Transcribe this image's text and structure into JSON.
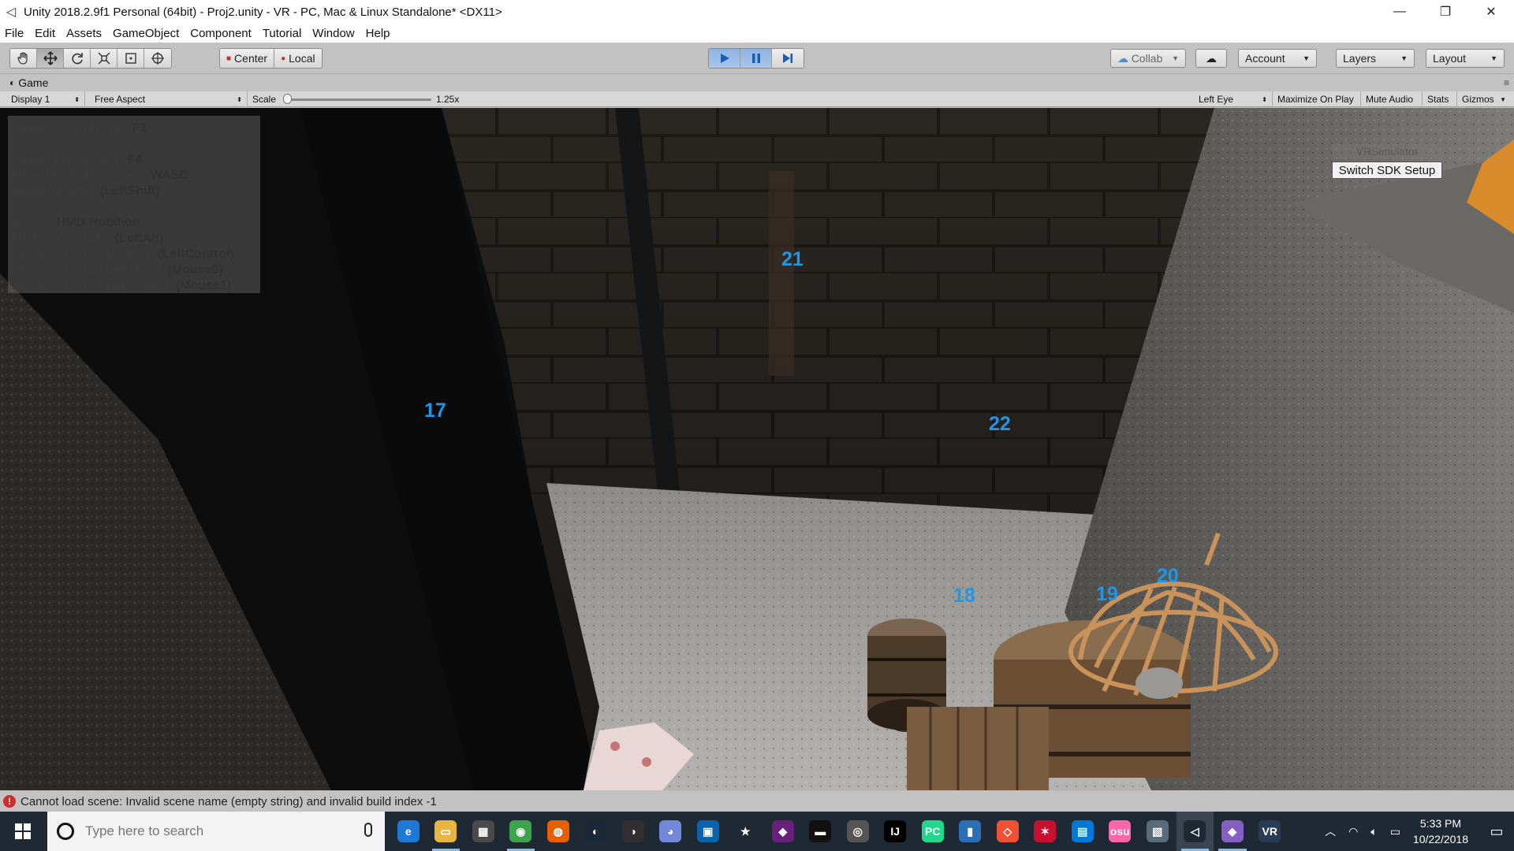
{
  "window": {
    "title": "Unity 2018.2.9f1 Personal (64bit) - Proj2.unity - VR - PC, Mac & Linux Standalone* <DX11>",
    "minimize_glyph": "—",
    "restore_glyph": "❐",
    "close_glyph": "✕"
  },
  "menu": [
    "File",
    "Edit",
    "Assets",
    "GameObject",
    "Component",
    "Tutorial",
    "Window",
    "Help"
  ],
  "toolbar": {
    "tools": [
      "hand-tool-icon",
      "move-tool-icon",
      "rotate-tool-icon",
      "scale-tool-icon",
      "rect-tool-icon",
      "transform-tool-icon"
    ],
    "pivot_center": "Center",
    "pivot_local": "Local",
    "collab": "Collab",
    "account": "Account",
    "layers": "Layers",
    "layout": "Layout"
  },
  "game_panel": {
    "tab_label": "Game",
    "display": "Display 1",
    "aspect": "Free Aspect",
    "scale_label": "Scale",
    "scale_value": "1.25x",
    "eye": "Left Eye",
    "maximize_on_play": "Maximize On Play",
    "mute_audio": "Mute Audio",
    "stats": "Stats",
    "gizmos": "Gizmos"
  },
  "hints": {
    "toggle_control_label": "Toggle Control Hints: ",
    "toggle_control_key": "F1",
    "toggle_mouse_label": "Toggle Mouse Lock: ",
    "toggle_mouse_key": "F4",
    "move_label": "Move Player/Playspace: ",
    "move_key": "WASD",
    "sprint_label": "Sprint Modifier: ",
    "sprint_key": "(LeftShift)",
    "mouse_label": "Mouse: ",
    "mouse_key": "HMD Rotation",
    "modes_label": "Modes: Controller ",
    "modes_key": "(LeftAlt)",
    "dist_mod_label": "Distance Pickup Modifier: ",
    "dist_mod_key": "(LeftControl)",
    "dist_left_label": "Distance Pickup Left Hand: ",
    "dist_left_key": "(Mouse0)",
    "dist_right_label": "Distance Pickup Right Hand: ",
    "dist_right_key": "(Mouse1)"
  },
  "sdk": {
    "simulator": "VRSimulator",
    "switch": "Switch SDK Setup"
  },
  "scene_labels": [
    "21",
    "17",
    "22",
    "20",
    "19",
    "18"
  ],
  "status": {
    "error": "Cannot load scene: Invalid scene name (empty string) and invalid build index -1"
  },
  "taskbar": {
    "search_placeholder": "Type here to search",
    "time": "5:33 PM",
    "date": "10/22/2018",
    "apps": [
      {
        "name": "edge-icon",
        "color": "#1e78d6",
        "glyph": "e"
      },
      {
        "name": "file-explorer-icon",
        "color": "#e8b640",
        "glyph": "▭"
      },
      {
        "name": "store-icon",
        "color": "#4a4a4a",
        "glyph": "▦"
      },
      {
        "name": "chrome-icon",
        "color": "#3fa34d",
        "glyph": "◉"
      },
      {
        "name": "firefox-icon",
        "color": "#e66000",
        "glyph": "◍"
      },
      {
        "name": "steam-icon",
        "color": "#1b2838",
        "glyph": "◐"
      },
      {
        "name": "obs-icon",
        "color": "#302e31",
        "glyph": "◑"
      },
      {
        "name": "discord-icon",
        "color": "#7289da",
        "glyph": "◕"
      },
      {
        "name": "outlook-icon",
        "color": "#0a64ad",
        "glyph": "▣"
      },
      {
        "name": "favorite-icon",
        "color": "#1f2933",
        "glyph": "★"
      },
      {
        "name": "visual-studio-icon",
        "color": "#68217a",
        "glyph": "◆"
      },
      {
        "name": "terminal-icon",
        "color": "#111111",
        "glyph": "▬"
      },
      {
        "name": "gamepad-icon",
        "color": "#555555",
        "glyph": "◎"
      },
      {
        "name": "intellij-icon",
        "color": "#000000",
        "glyph": "IJ"
      },
      {
        "name": "pycharm-icon",
        "color": "#21d789",
        "glyph": "PC"
      },
      {
        "name": "bookmark-app-icon",
        "color": "#2c6fb5",
        "glyph": "▮"
      },
      {
        "name": "git-icon",
        "color": "#f05033",
        "glyph": "◇"
      },
      {
        "name": "maple-icon",
        "color": "#c8102e",
        "glyph": "✶"
      },
      {
        "name": "remote-desktop-icon",
        "color": "#0078d7",
        "glyph": "▤"
      },
      {
        "name": "osu-icon",
        "color": "#ff66aa",
        "glyph": "osu"
      },
      {
        "name": "photos-icon",
        "color": "#5a6b7b",
        "glyph": "▧"
      },
      {
        "name": "unity-icon",
        "color": "#1f2933",
        "glyph": "◁"
      },
      {
        "name": "visual-studio-2-icon",
        "color": "#865fc5",
        "glyph": "◆"
      },
      {
        "name": "vr-icon",
        "color": "#2b3a55",
        "glyph": "VR"
      }
    ]
  }
}
